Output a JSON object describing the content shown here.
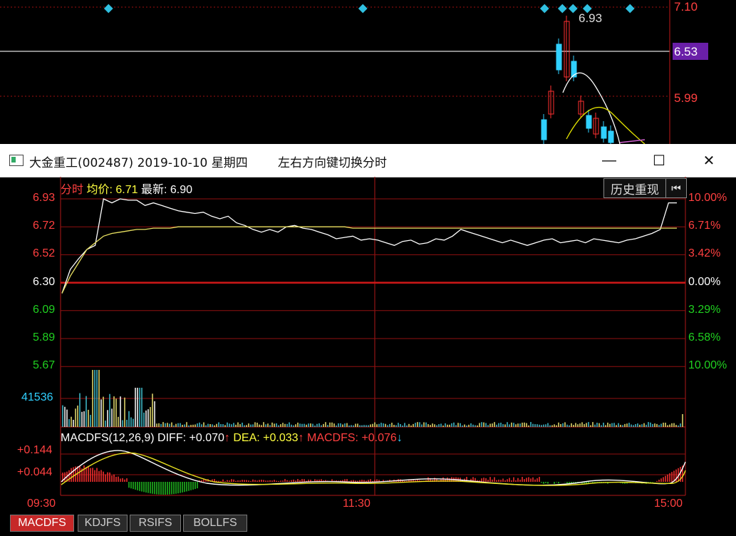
{
  "background_chart": {
    "price_labels": [
      "7.10",
      "6.53",
      "5.99"
    ],
    "annotation": "6.93",
    "colors": {
      "up": "#ff3030",
      "down": "#30d0ff",
      "ma1": "#ffffff",
      "ma2": "#e0e000"
    }
  },
  "window": {
    "title": "大金重工(002487) 2019-10-10 星期四",
    "hint": "左右方向键切换分时",
    "controls": {
      "minimize": "—",
      "maximize": "☐",
      "close": "✕"
    }
  },
  "header": {
    "mode_label": "分时",
    "avg_label": "均价:",
    "avg_value": "6.71",
    "latest_label": "最新:",
    "latest_value": "6.90",
    "history_button": "历史重现",
    "back_button_icon": "back-arrow-icon"
  },
  "price_axis_left": [
    {
      "value": "6.93",
      "color": "#ff4040"
    },
    {
      "value": "6.72",
      "color": "#ff4040"
    },
    {
      "value": "6.52",
      "color": "#ff4040"
    },
    {
      "value": "6.30",
      "color": "#ffffff"
    },
    {
      "value": "6.09",
      "color": "#20d020"
    },
    {
      "value": "5.89",
      "color": "#20d020"
    },
    {
      "value": "5.67",
      "color": "#20d020"
    }
  ],
  "pct_axis_right": [
    {
      "value": "10.00%",
      "color": "#ff4040"
    },
    {
      "value": "6.71%",
      "color": "#ff4040"
    },
    {
      "value": "3.42%",
      "color": "#ff4040"
    },
    {
      "value": "0.00%",
      "color": "#ffffff"
    },
    {
      "value": "3.29%",
      "color": "#20d020"
    },
    {
      "value": "6.58%",
      "color": "#20d020"
    },
    {
      "value": "10.00%",
      "color": "#20d020"
    }
  ],
  "volume_label": "41536",
  "macd": {
    "name": "MACDFS(12,26,9)",
    "diff_label": "DIFF:",
    "diff_value": "+0.070",
    "diff_arrow": "↑",
    "dea_label": "DEA:",
    "dea_value": "+0.033",
    "dea_arrow": "↑",
    "macd_label": "MACDFS:",
    "macd_value": "+0.076",
    "macd_arrow": "↓",
    "axis": [
      "+0.144",
      "+0.044"
    ]
  },
  "time_axis": [
    "09:30",
    "11:30",
    "15:00"
  ],
  "tabs": [
    "MACDFS",
    "KDJFS",
    "RSIFS",
    "BOLLFS"
  ],
  "chart_data": {
    "type": "line",
    "x_range": [
      "09:30",
      "15:00"
    ],
    "ylim": [
      5.67,
      6.93
    ],
    "series": [
      {
        "values": [
          6.22,
          6.4,
          6.48,
          6.55,
          6.58,
          6.93,
          6.9,
          6.93,
          6.92,
          6.92,
          6.88,
          6.9,
          6.88,
          6.86,
          6.84,
          6.83,
          6.82,
          6.83,
          6.8,
          6.78,
          6.8,
          6.75,
          6.73,
          6.7,
          6.68,
          6.7,
          6.68,
          6.72,
          6.73,
          6.71,
          6.7,
          6.68,
          6.66,
          6.63,
          6.64,
          6.65,
          6.62,
          6.63,
          6.62,
          6.6,
          6.58,
          6.61,
          6.62,
          6.59,
          6.6,
          6.63,
          6.62,
          6.65,
          6.7,
          6.68,
          6.66,
          6.64,
          6.62,
          6.6,
          6.62,
          6.6,
          6.58,
          6.6,
          6.62,
          6.63,
          6.6,
          6.61,
          6.62,
          6.6,
          6.63,
          6.62,
          6.61,
          6.6,
          6.62,
          6.63,
          6.65,
          6.67,
          6.7,
          6.9,
          6.9
        ]
      },
      {
        "values": [
          6.22,
          6.35,
          6.45,
          6.55,
          6.6,
          6.65,
          6.67,
          6.68,
          6.69,
          6.7,
          6.7,
          6.71,
          6.71,
          6.71,
          6.72,
          6.72,
          6.72,
          6.72,
          6.72,
          6.72,
          6.72,
          6.72,
          6.72,
          6.72,
          6.72,
          6.72,
          6.72,
          6.72,
          6.72,
          6.72,
          6.72,
          6.72,
          6.72,
          6.72,
          6.72,
          6.71,
          6.71,
          6.71,
          6.71,
          6.71,
          6.71,
          6.71,
          6.71,
          6.71,
          6.71,
          6.71,
          6.71,
          6.71,
          6.71,
          6.71,
          6.71,
          6.71,
          6.71,
          6.71,
          6.71,
          6.71,
          6.71,
          6.71,
          6.71,
          6.71,
          6.71,
          6.71,
          6.71,
          6.71,
          6.71,
          6.71,
          6.71,
          6.71,
          6.71,
          6.71,
          6.71,
          6.71,
          6.71,
          6.71,
          6.71
        ]
      }
    ]
  }
}
